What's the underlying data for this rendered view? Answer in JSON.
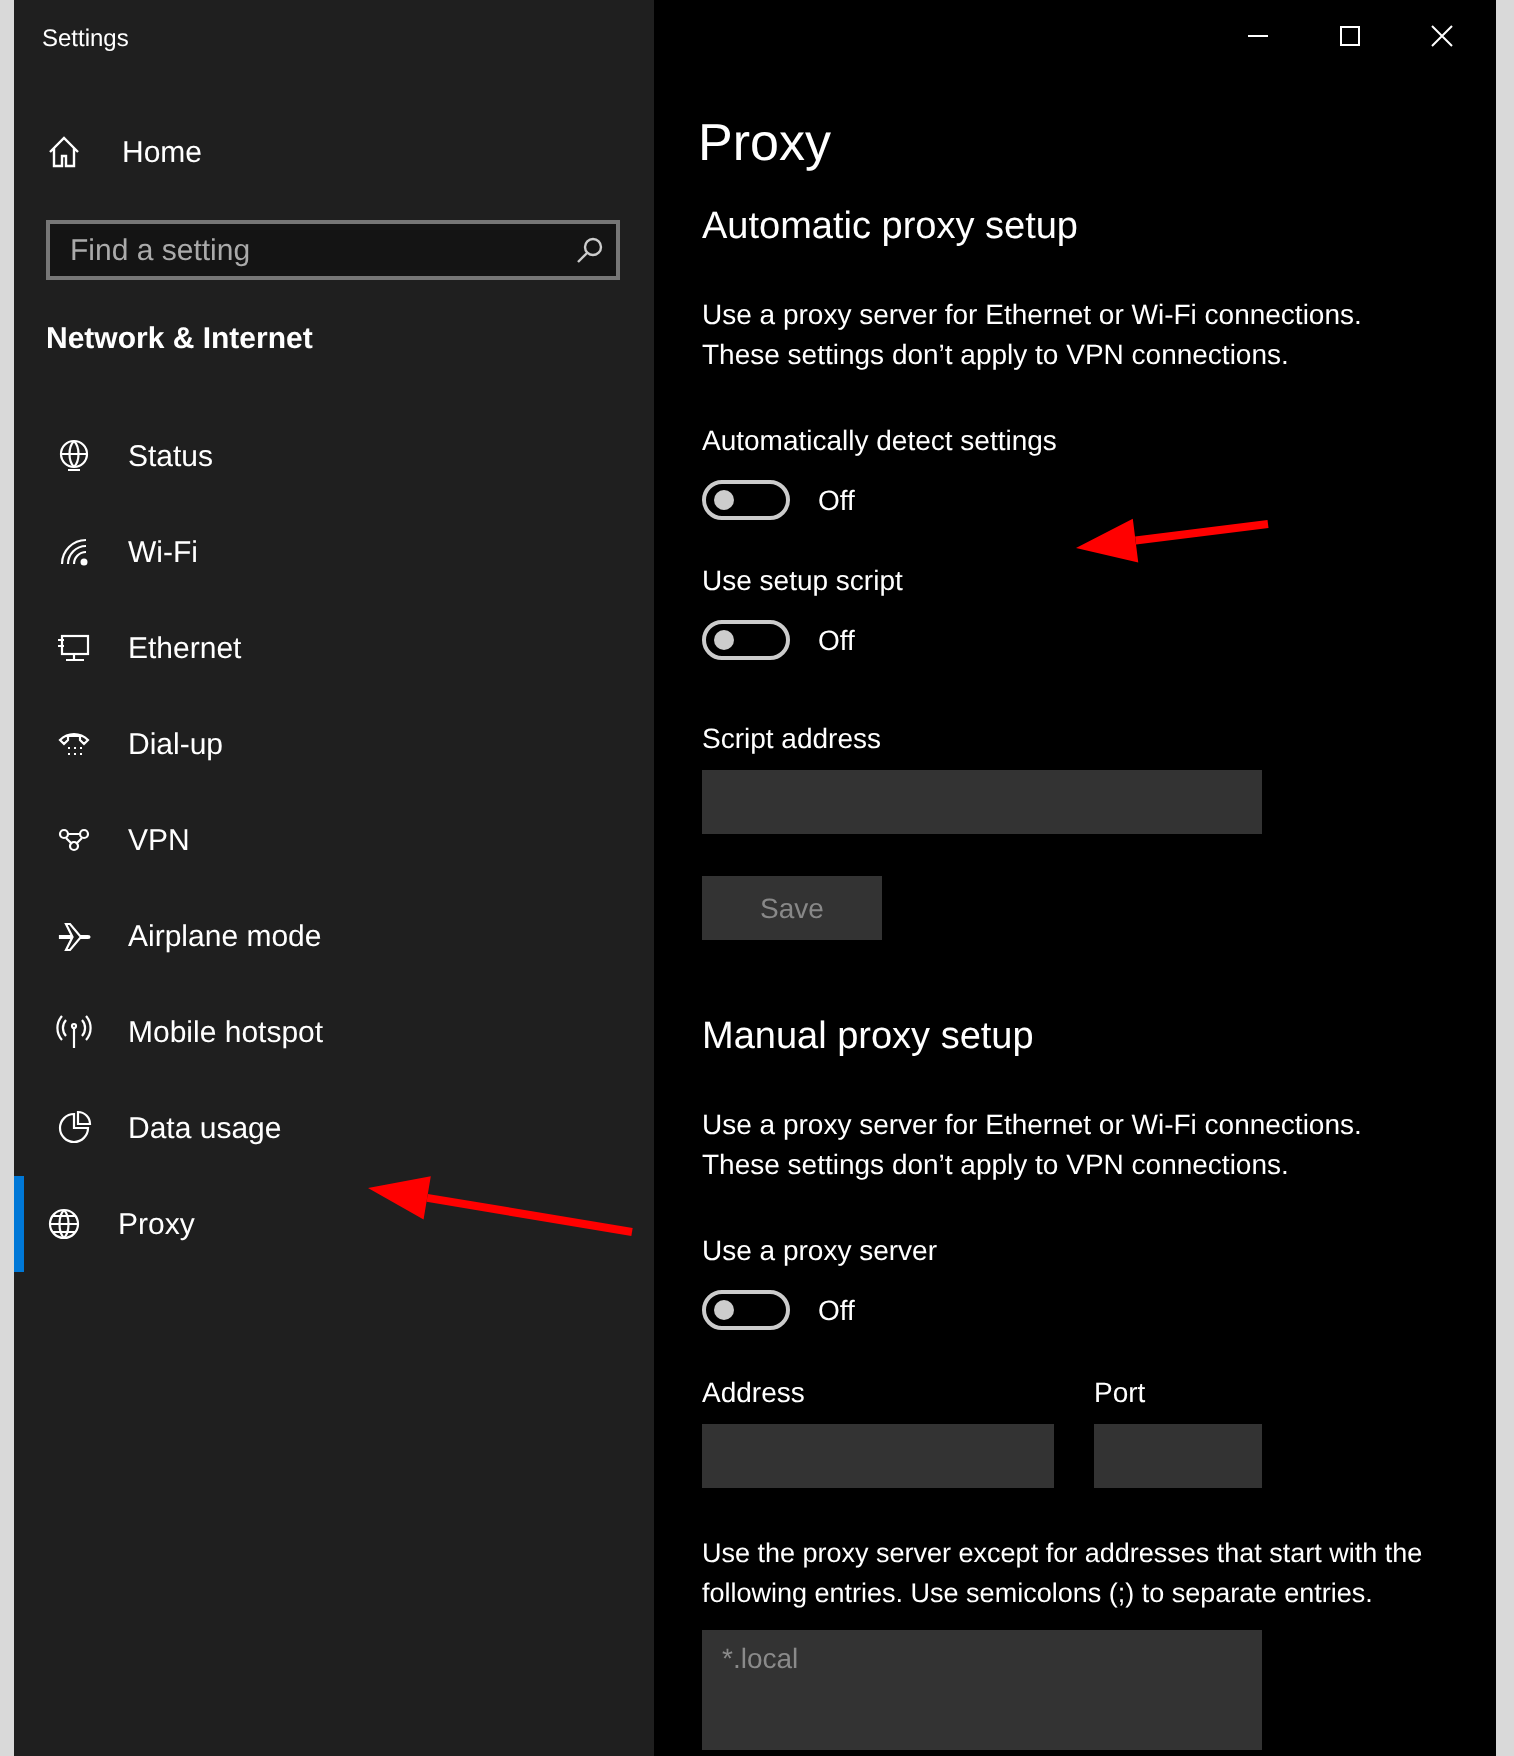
{
  "window": {
    "title": "Settings"
  },
  "sidebar": {
    "home": "Home",
    "search": {
      "placeholder": "Find a setting"
    },
    "section": "Network & Internet",
    "items": [
      {
        "label": "Status",
        "selected": false
      },
      {
        "label": "Wi-Fi",
        "selected": false
      },
      {
        "label": "Ethernet",
        "selected": false
      },
      {
        "label": "Dial-up",
        "selected": false
      },
      {
        "label": "VPN",
        "selected": false
      },
      {
        "label": "Airplane mode",
        "selected": false
      },
      {
        "label": "Mobile hotspot",
        "selected": false
      },
      {
        "label": "Data usage",
        "selected": false
      },
      {
        "label": "Proxy",
        "selected": true
      }
    ]
  },
  "page": {
    "title": "Proxy"
  },
  "automatic": {
    "heading": "Automatic proxy setup",
    "description": "Use a proxy server for Ethernet or Wi-Fi connections. These settings don’t apply to VPN connections.",
    "settings": [
      {
        "label": "Automatically detect settings",
        "on": false,
        "state_text": "Off"
      },
      {
        "label": "Use setup script",
        "on": false,
        "state_text": "Off"
      }
    ],
    "script_address": {
      "label": "Script address"
    },
    "save_button": {
      "label": "Save",
      "disabled": true
    }
  },
  "manual": {
    "heading": "Manual proxy setup",
    "description": "Use a proxy server for Ethernet or Wi-Fi connections. These settings don’t apply to VPN connections.",
    "setting": {
      "label": "Use a proxy server",
      "on": false,
      "state_text": "Off"
    },
    "address": {
      "label": "Address"
    },
    "port": {
      "label": "Port"
    },
    "exceptions": {
      "label": "Use the proxy server except for addresses that start with the following entries. Use semicolons (;) to separate entries.",
      "value": "*.local",
      "disabled": true
    }
  },
  "annotations": [
    {
      "kind": "arrow"
    },
    {
      "kind": "arrow"
    }
  ]
}
